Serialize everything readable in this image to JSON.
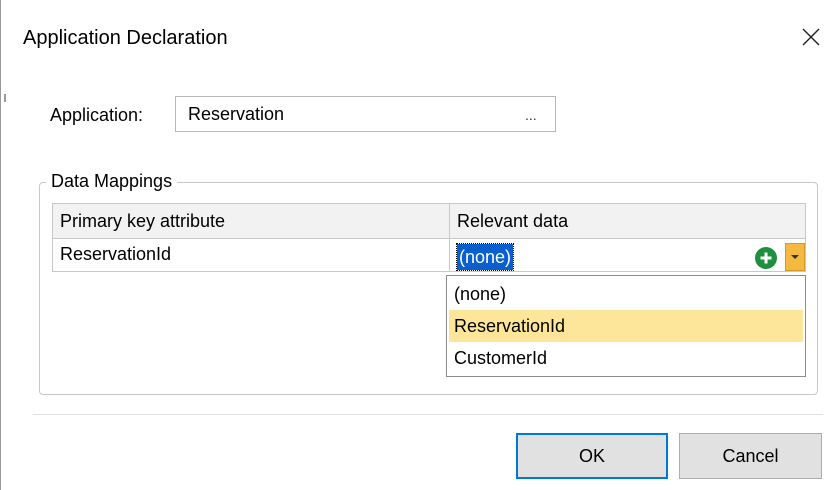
{
  "dialog": {
    "title": "Application Declaration"
  },
  "application": {
    "label": "Application:",
    "value": "Reservation",
    "browse_label": "..."
  },
  "data_mappings": {
    "group_title": "Data Mappings",
    "columns": [
      "Primary key attribute",
      "Relevant data"
    ],
    "rows": [
      {
        "primary_key": "ReservationId",
        "relevant_data": "(none)"
      }
    ],
    "dropdown_options": [
      "(none)",
      "ReservationId",
      "CustomerId"
    ],
    "highlighted_option": "ReservationId"
  },
  "buttons": {
    "ok": "OK",
    "cancel": "Cancel"
  },
  "icons": {
    "close": "close-icon",
    "add": "plus-circle-icon",
    "dropdown": "chevron-down-icon"
  },
  "colors": {
    "selection": "#0a5fcf",
    "highlight": "#fde59a",
    "add_icon": "#1e8f3e",
    "dropdown_button": "#f5b940",
    "ok_border": "#0078d7"
  }
}
